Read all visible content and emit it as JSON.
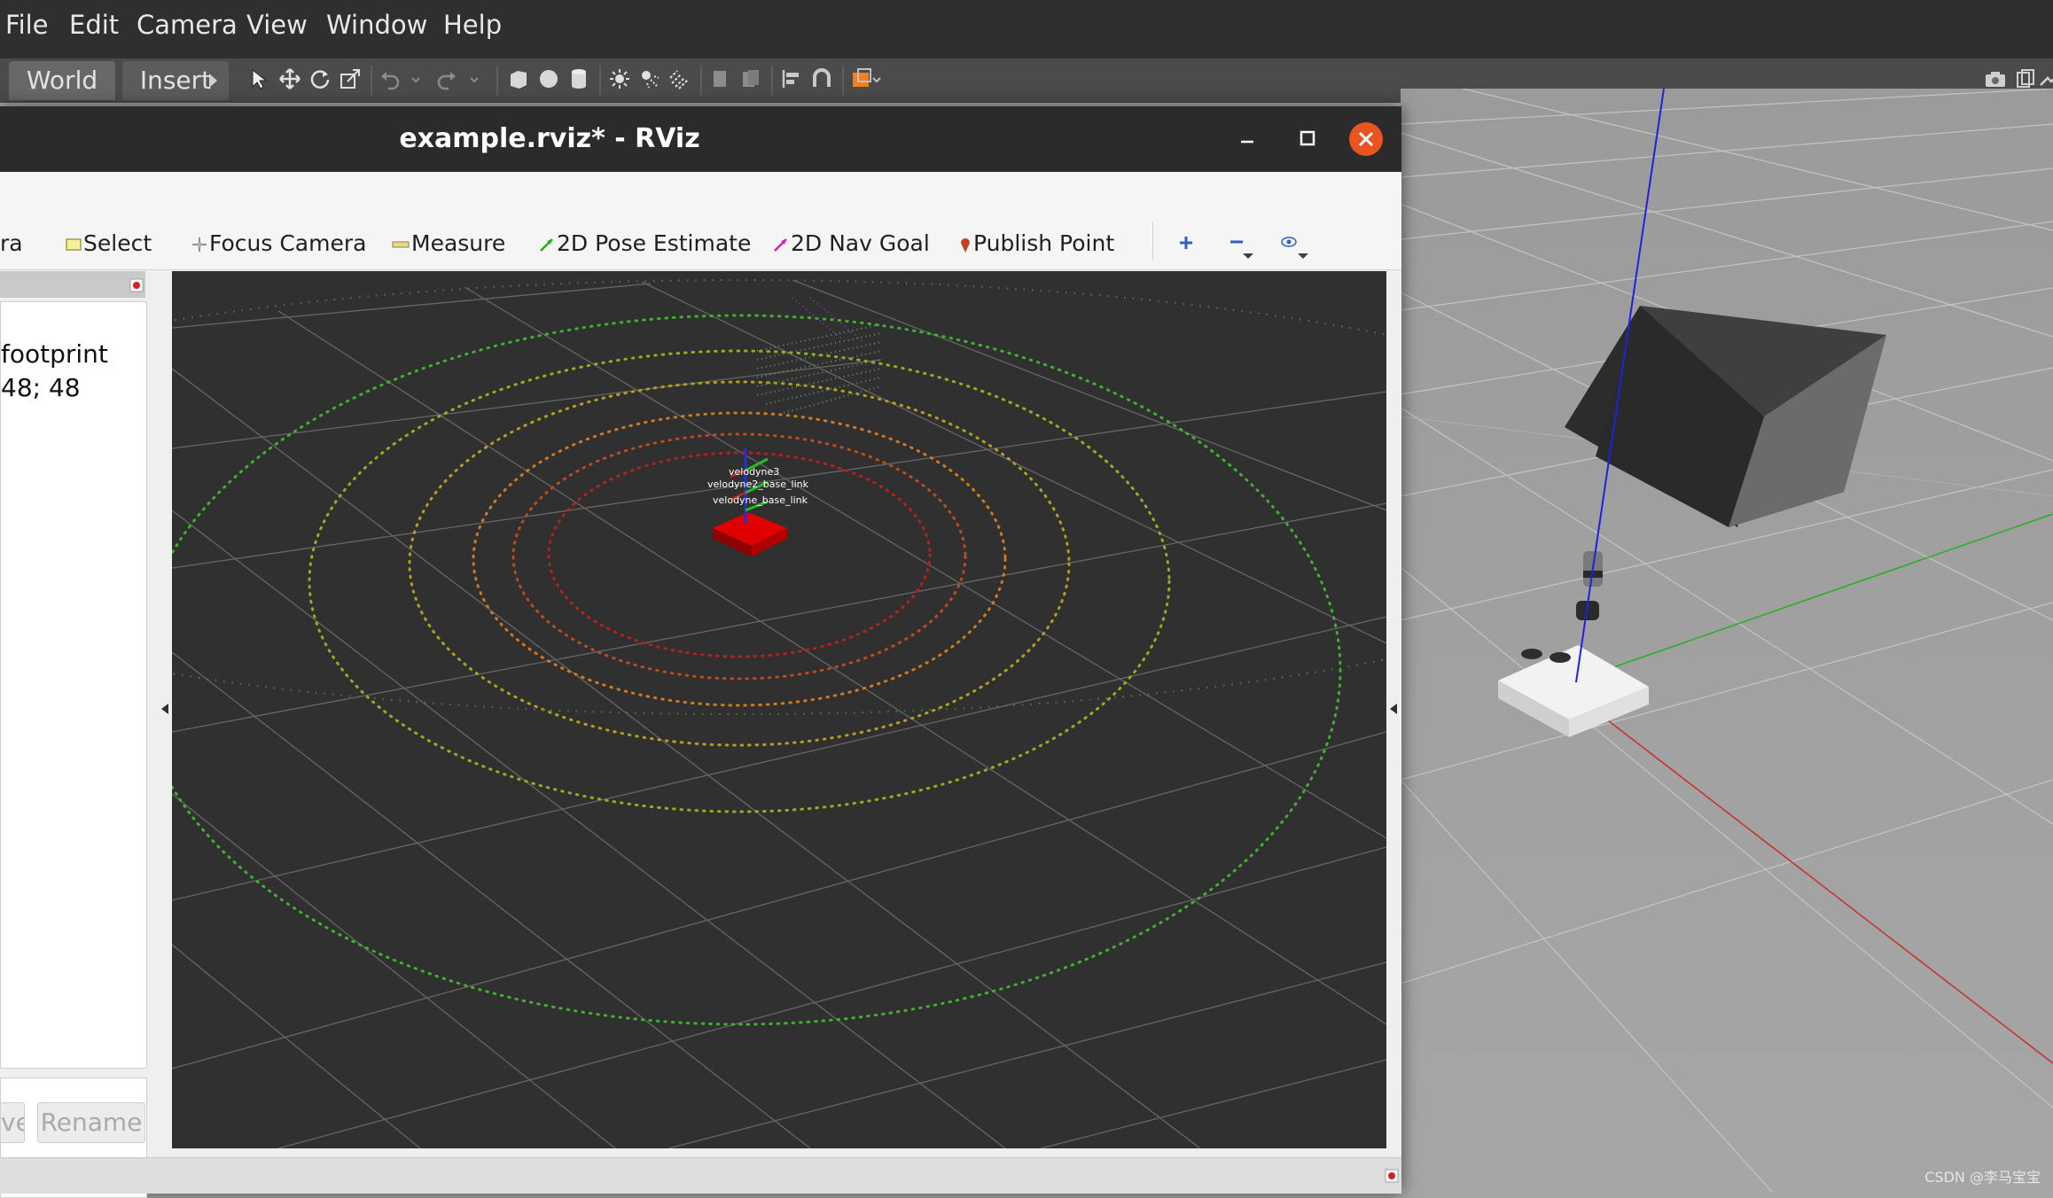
{
  "gazebo": {
    "menu": [
      "File",
      "Edit",
      "Camera",
      "View",
      "Window",
      "Help"
    ],
    "tabs": [
      "World",
      "Insert"
    ]
  },
  "rviz": {
    "title": "example.rviz* - RViz",
    "toolbar": {
      "partial_first": "ra",
      "select": "Select",
      "focus_camera": "Focus Camera",
      "measure": "Measure",
      "pose_estimate": "2D Pose Estimate",
      "nav_goal": "2D Nav Goal",
      "publish_point": "Publish Point"
    },
    "left_panel": {
      "line1": "footprint",
      "line2": "48; 48",
      "btn_partial": "ve",
      "btn_rename": "Rename"
    },
    "viewport": {
      "frame_labels": [
        "velodyne3",
        "velodyne2_base_link",
        "velodyne_base_link"
      ]
    }
  },
  "colors": {
    "gazebo_bg": "#a5a5a5",
    "rviz_bg": "#303030",
    "title_close": "#e95420"
  },
  "watermark": "CSDN @李马宝宝"
}
